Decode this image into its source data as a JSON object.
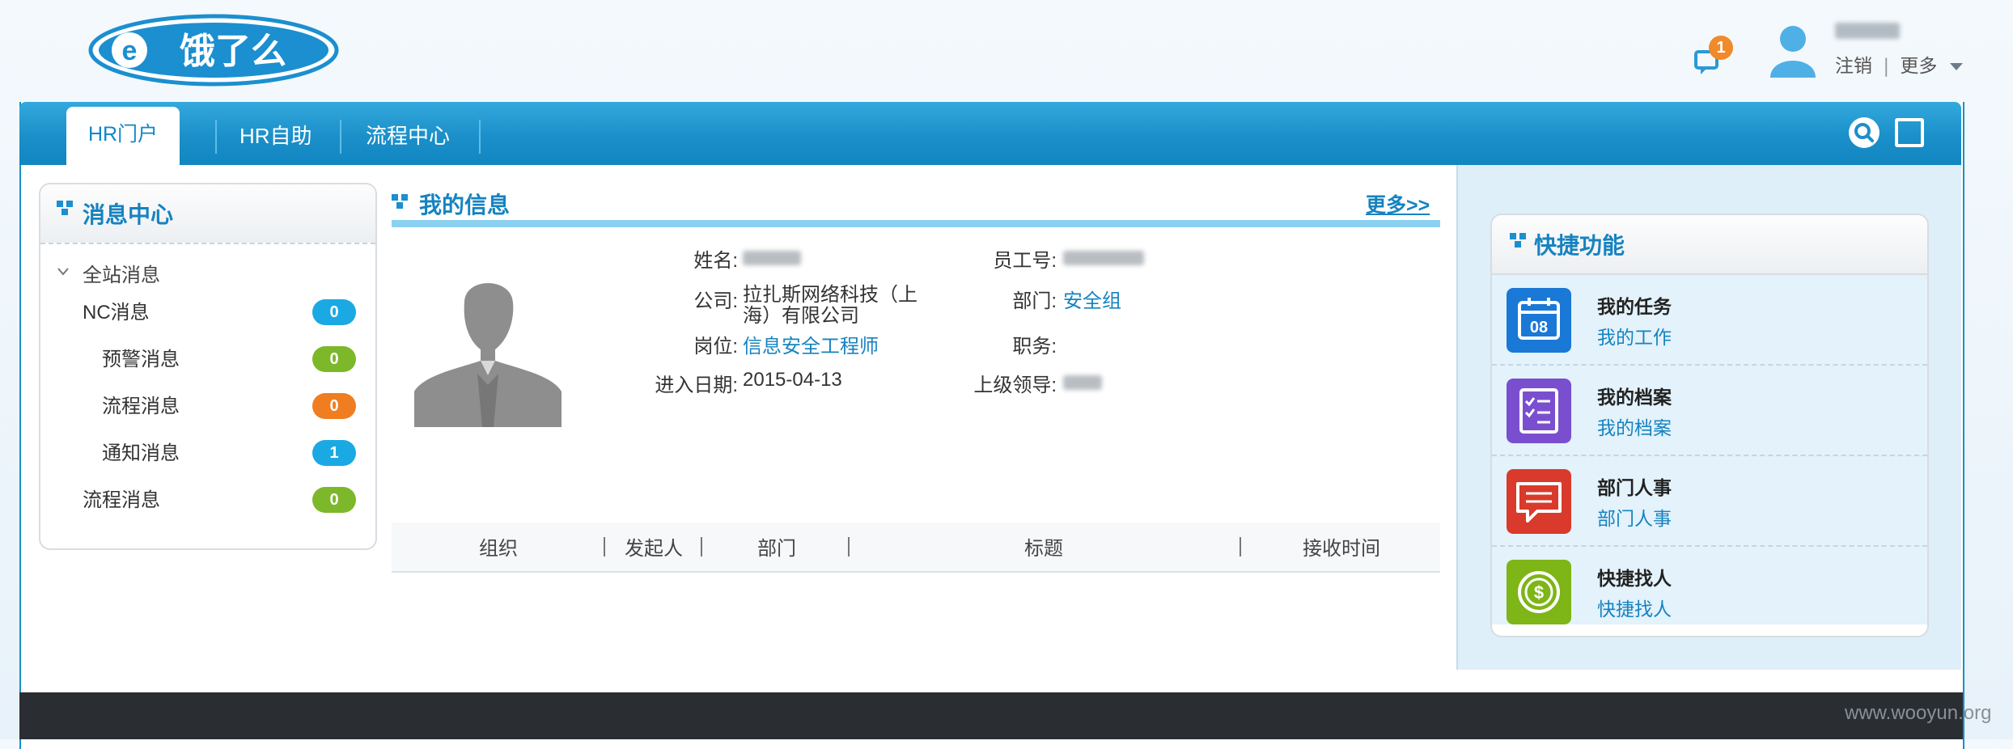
{
  "header": {
    "logo_text": "e饿了么",
    "notification_count": "1",
    "logout": "注销",
    "separator": "|",
    "more": "更多"
  },
  "nav": {
    "tabs": [
      {
        "label": "HR门户",
        "active": true
      },
      {
        "label": "HR自助",
        "active": false
      },
      {
        "label": "流程中心",
        "active": false
      }
    ]
  },
  "message_center": {
    "title": "消息中心",
    "group_label": "全站消息",
    "items": [
      {
        "label": "NC消息",
        "count": "0",
        "color": "#1ba9e3"
      },
      {
        "label": "预警消息",
        "count": "0",
        "color": "#7cb829"
      },
      {
        "label": "流程消息",
        "count": "0",
        "color": "#f07d1f"
      },
      {
        "label": "通知消息",
        "count": "1",
        "color": "#1ba9e3"
      },
      {
        "label": "流程消息",
        "count": "0",
        "color": "#7cb829"
      }
    ]
  },
  "my_info": {
    "title": "我的信息",
    "more": "更多>>",
    "fields": {
      "name_label": "姓名:",
      "emp_no_label": "员工号:",
      "company_label": "公司:",
      "company_value": "拉扎斯网络科技（上海）有限公司",
      "department_label": "部门:",
      "department_value": "安全组",
      "position_label": "岗位:",
      "position_value": "信息安全工程师",
      "duty_label": "职务:",
      "join_date_label": "进入日期:",
      "join_date_value": "2015-04-13",
      "leader_label": "上级领导:"
    },
    "table_headers": [
      "组织",
      "发起人",
      "部门",
      "标题",
      "接收时间"
    ]
  },
  "quick": {
    "title": "快捷功能",
    "items": [
      {
        "title": "我的任务",
        "sub": "我的工作",
        "icon": "calendar-icon",
        "color": "#1a78d6",
        "badge": "08"
      },
      {
        "title": "我的档案",
        "sub": "我的档案",
        "icon": "checklist-icon",
        "color": "#7a4fcf"
      },
      {
        "title": "部门人事",
        "sub": "部门人事",
        "icon": "chat-list-icon",
        "color": "#d93a2b"
      },
      {
        "title": "快捷找人",
        "sub": "快捷找人",
        "icon": "coin-icon",
        "color": "#7eb517"
      }
    ]
  },
  "watermark": "www.wooyun.org"
}
